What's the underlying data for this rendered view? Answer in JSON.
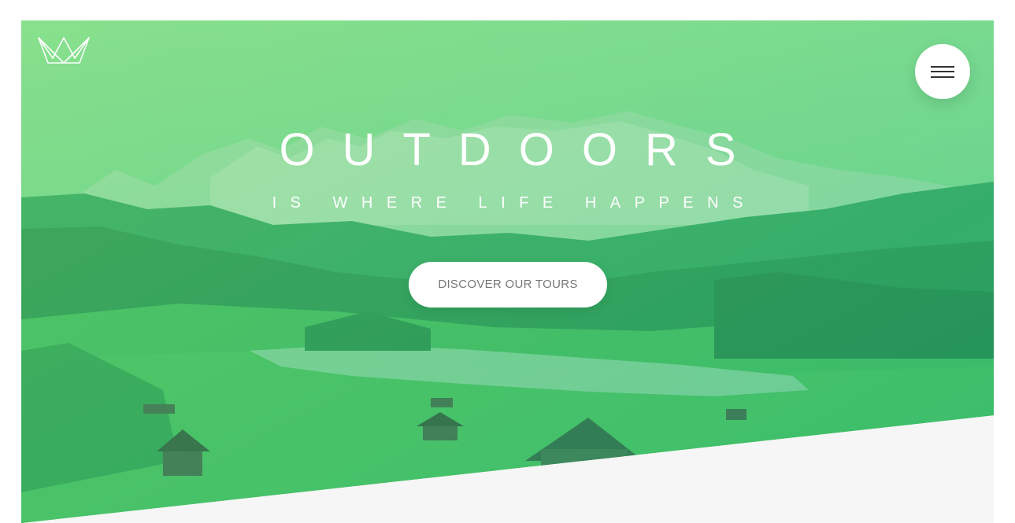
{
  "header": {
    "logo_icon": "crown-logo-icon",
    "menu_icon": "hamburger-menu-icon"
  },
  "hero": {
    "title": "OUTDOORS",
    "subtitle": "IS WHERE LIFE HAPPENS",
    "cta_label": "DISCOVER OUR TOURS",
    "overlay_colors": [
      "#7ed56f",
      "#28b485"
    ]
  }
}
